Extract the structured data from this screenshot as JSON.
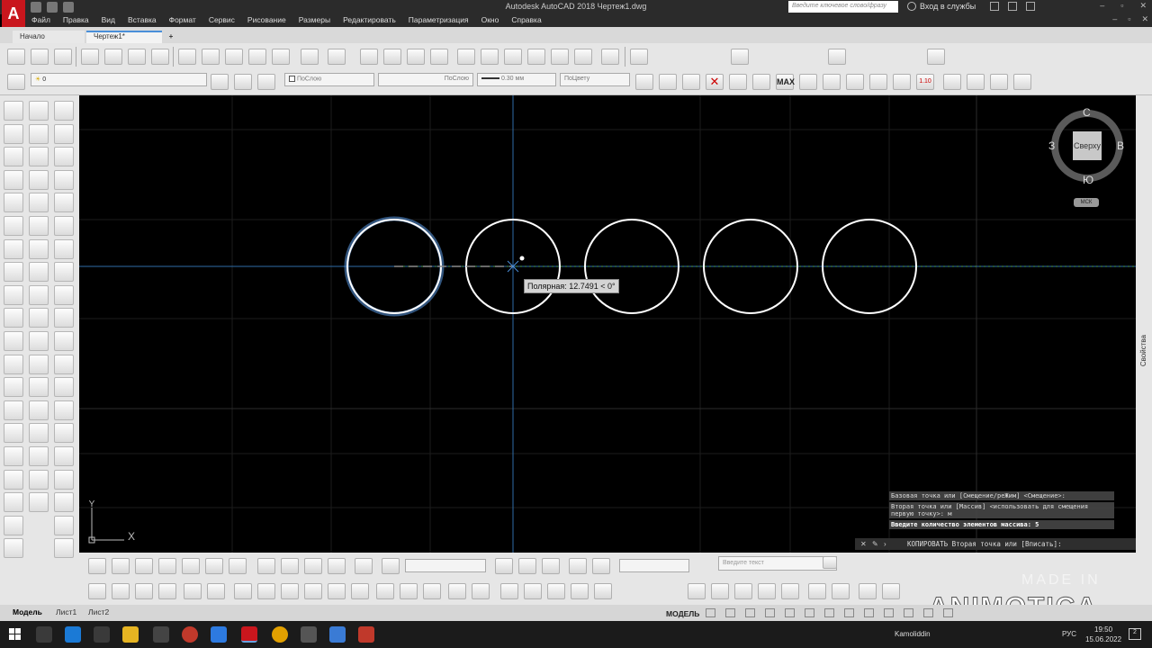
{
  "titlebar": {
    "title": "Autodesk AutoCAD 2018    Чертеж1.dwg",
    "search_placeholder": "Введите ключевое слово/фразу",
    "signin_label": "Вход в службы",
    "logo_letter": "A"
  },
  "menubar": {
    "items": [
      "Файл",
      "Правка",
      "Вид",
      "Вставка",
      "Формат",
      "Сервис",
      "Рисование",
      "Размеры",
      "Редактировать",
      "Параметризация",
      "Окно",
      "Справка"
    ]
  },
  "file_tabs": {
    "start": "Начало",
    "drawing": "Чертеж1*",
    "add": "+"
  },
  "toolbar": {
    "layer_value": "0",
    "color_dropdown": "ПоСлою",
    "linetype_dropdown": "ПоСлою",
    "lineweight_dropdown": "0.30 мм",
    "plotstyle_dropdown": "ПоЦвету",
    "dim_max_label": "MAX",
    "dim_scale_label": "1.10"
  },
  "viewcube": {
    "north": "С",
    "south": "Ю",
    "west": "З",
    "east": "В",
    "top_label": "Сверху",
    "wcs_label": "МСК"
  },
  "canvas": {
    "polar_tooltip": "Полярная: 12.7491 < 0°",
    "ucs_x": "X",
    "ucs_y": "Y",
    "accent_color": "#4a8fd9"
  },
  "command": {
    "history": [
      "Базовая точка или [Смещение/реЖим] <Смещение>:",
      "Вторая точка или [Массив] <использовать для смещения первую точку>: м",
      "Введите количество элементов массива: 5"
    ],
    "current_prompt": "КОПИРОВАТЬ Вторая точка или [Вписать]:"
  },
  "bottom": {
    "text_placeholder": "Введите текст"
  },
  "layout_tabs": [
    "Модель",
    "Лист1",
    "Лист2"
  ],
  "status": {
    "model_label": "МОДЕЛЬ"
  },
  "watermark": {
    "small": "MADE IN",
    "big": "ANIMOTICA"
  },
  "properties_label": "Свойства",
  "taskbar": {
    "user": "Kamoliddin",
    "lang": "РУС",
    "time": "19:50",
    "date": "15.06.2022",
    "notifications": "2"
  }
}
